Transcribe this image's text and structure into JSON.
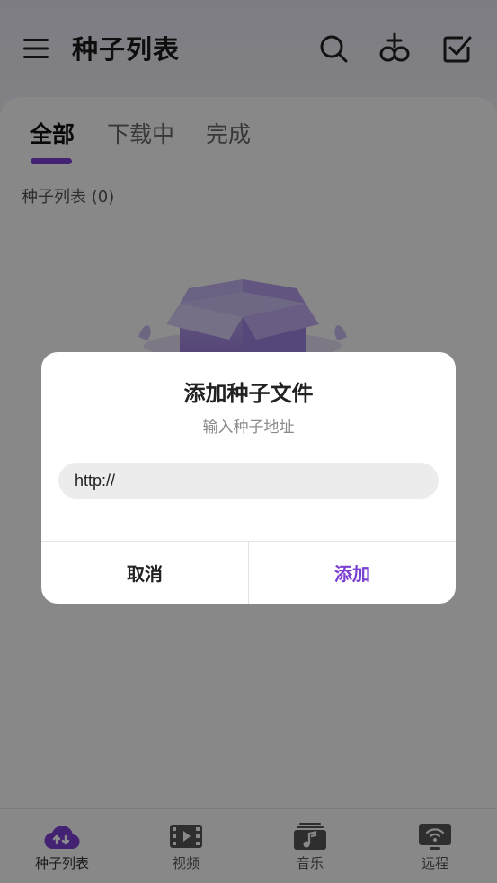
{
  "app_bar": {
    "title": "种子列表",
    "icons": [
      "menu-icon",
      "search-icon",
      "add-link-icon",
      "select-check-icon"
    ]
  },
  "tabs": [
    {
      "label": "全部",
      "active": true
    },
    {
      "label": "下载中",
      "active": false
    },
    {
      "label": "完成",
      "active": false
    }
  ],
  "list": {
    "count_label": "种子列表 (0)"
  },
  "dialog": {
    "title": "添加种子文件",
    "subtitle": "输入种子地址",
    "input_value": "http://",
    "cancel_label": "取消",
    "confirm_label": "添加"
  },
  "bottom_nav": [
    {
      "label": "种子列表",
      "icon": "cloud-transfer-icon",
      "active": true
    },
    {
      "label": "视频",
      "icon": "film-icon",
      "active": false
    },
    {
      "label": "音乐",
      "icon": "music-icon",
      "active": false
    },
    {
      "label": "远程",
      "icon": "remote-screen-icon",
      "active": false
    }
  ],
  "colors": {
    "accent": "#7b3fd2",
    "scrim": "rgba(0,0,0,0.45)",
    "dialog_bg": "#ffffff"
  }
}
